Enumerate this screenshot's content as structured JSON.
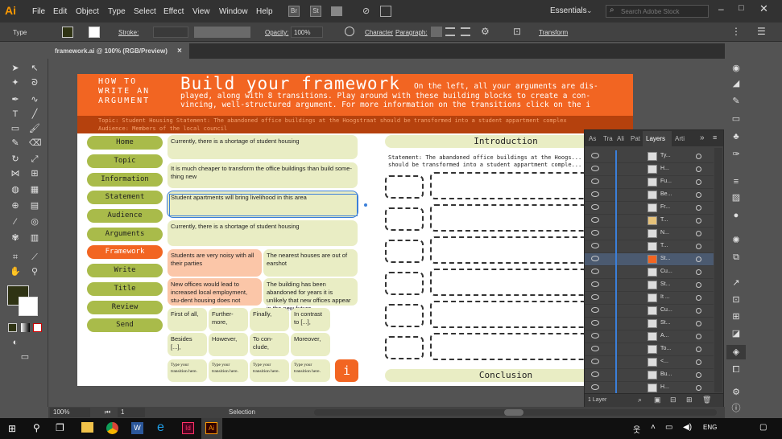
{
  "menubar": {
    "logo": "Ai",
    "items": [
      "File",
      "Edit",
      "Object",
      "Type",
      "Select",
      "Effect",
      "View",
      "Window",
      "Help"
    ],
    "workspace": "Essentials",
    "search_placeholder": "Search Adobe Stock"
  },
  "control_bar": {
    "type_label": "Type",
    "stroke_label": "Stroke:",
    "opacity_label": "Opacity:",
    "opacity_value": "100%",
    "character_label": "Character",
    "paragraph_label": "Paragraph:",
    "transform_label": "Transform"
  },
  "document_tab": {
    "label": "framework.ai @ 100% (RGB/Preview)",
    "close": "×"
  },
  "artboard": {
    "header_left": [
      "HOW TO",
      "WRITE AN",
      "ARGUMENT"
    ],
    "header_title": "Build your framework",
    "header_text_1": "On the left, all your arguments are dis-",
    "header_text_2": "played, along with 8 transitions. Play around with these building blocks to create a con-",
    "header_text_3": "vincing, well-structured argument. For more information on the transitions click on the i",
    "topic_line": "Topic: Student Housing     Statement: The abandoned office buildings at the Hoogstraat should be transformed into a student appartment complex",
    "audience_line": "Audience: Members of the local council",
    "nav": [
      "Home",
      "Topic",
      "Information",
      "Statement",
      "Audience",
      "Arguments",
      "Framework",
      "Write",
      "Title",
      "Review",
      "Send"
    ],
    "active_nav": "Framework",
    "cards": {
      "c1": "Currently, there is a shortage of student housing",
      "c2": "It is much cheaper to transform the office buildings than build some-thing new",
      "c3": "Student apartments will bring livelihood in this area",
      "c4": "Currently, there is a shortage of student housing",
      "c5": "Students are very noisy with all their parties",
      "c6": "The nearest houses are out of earshot",
      "c7": "New offices would lead to increased local employment, stu-dent housing does not",
      "c8": "The building has been abandoned for years it is unlikely that new offices appear in the new future"
    },
    "transitions": [
      "First of all,",
      "Further-more,",
      "Finally,",
      "In contrast to [...],",
      "Besides [...],",
      "However,",
      "To con-clude,",
      "Moreover,"
    ],
    "type_here": "Type your transition here.",
    "info_button": "i",
    "introduction": "Introduction",
    "statement_text": "Statement: The abandoned office buildings at the Hoogs... should be transformed into a student appartment comple...",
    "conclusion": "Conclusion"
  },
  "layers_panel": {
    "tabs": [
      "As",
      "Tra",
      "Ali",
      "Pat",
      "Layers",
      "Arti"
    ],
    "active_tab": "Layers",
    "rows": [
      "Ty...",
      "H...",
      "Fu...",
      "Be...",
      "Fr...",
      "T...",
      "N...",
      "T...",
      "St...",
      "Cu...",
      "St...",
      "It ...",
      "Cu...",
      "St...",
      "A...",
      "To...",
      "<...",
      "Bu...",
      "H..."
    ],
    "footer": "1 Layer"
  },
  "status": {
    "zoom": "100%",
    "page": "1",
    "tool": "Selection"
  },
  "taskbar": {
    "lang": "ENG"
  }
}
